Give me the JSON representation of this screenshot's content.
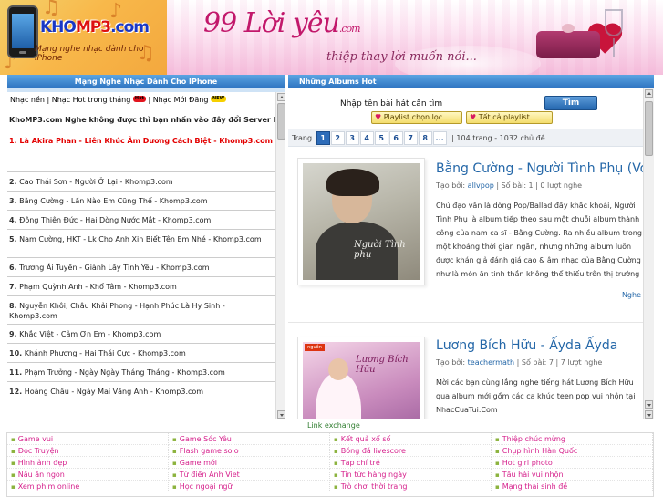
{
  "header": {
    "logo_text_a": "KHO",
    "logo_text_b": "MP3",
    "logo_text_c": ".com",
    "logo_tagline": "Mạng nghe nhạc dành cho iPhone",
    "banner_title": "99 Lời yêu",
    "banner_domain": ".com",
    "banner_subtitle": "thiệp thay lời muốn nói..."
  },
  "left": {
    "heading": "Mạng Nghe Nhạc Dành Cho IPhone",
    "tabs": [
      "Nhạc nền",
      "Nhạc Hot trong tháng",
      "Nhạc Mới Đăng"
    ],
    "tab_sep": " | ",
    "hot_badge": "Hot",
    "new_badge": "NEW",
    "intro": "KhoMP3.com Nghe không được thì bạn nhấn vào đây đổi Server khác",
    "featured_num": "1.",
    "featured": "Là Akira Phan - Liên Khúc Âm Dương Cách Biệt - Khomp3.com",
    "songs": [
      {
        "num": "2.",
        "text": "Cao Thái Sơn - Người Ở Lại - Khomp3.com"
      },
      {
        "num": "3.",
        "text": "Bằng Cường - Lần Nào Em Cũng Thế - Khomp3.com"
      },
      {
        "num": "4.",
        "text": "Đông Thiên Đức - Hai Dòng Nước Mắt - Khomp3.com"
      },
      {
        "num": "5.",
        "text": "Nam Cường, HKT - Lk Cho Anh Xin Biết Tên Em Nhé - Khomp3.com"
      },
      {
        "num": "6.",
        "text": "Trương Ái Tuyền - Giành Lấy Tình Yêu - Khomp3.com"
      },
      {
        "num": "7.",
        "text": "Phạm Quỳnh Anh - Khổ Tâm - Khomp3.com"
      },
      {
        "num": "8.",
        "text": "Nguyễn Khôi, Châu Khải Phong - Hạnh Phúc Là Hy Sinh - Khomp3.com"
      },
      {
        "num": "9.",
        "text": "Khắc Việt - Cảm Ơn Em - Khomp3.com"
      },
      {
        "num": "10.",
        "text": "Khánh Phương - Hai Thái Cực - Khomp3.com"
      },
      {
        "num": "11.",
        "text": "Phạm Trưởng - Ngày Ngày Tháng Tháng - Khomp3.com"
      },
      {
        "num": "12.",
        "text": "Hoàng Châu - Ngày Mai Vắng Anh - Khomp3.com"
      }
    ]
  },
  "right": {
    "heading": "Những Albums Hot",
    "search_value": "Nhập tên bài hát cần tìm",
    "search_button": "Tìm",
    "playlist_chosen": "Playlist chọn lọc",
    "playlist_all": "Tất cả playlist",
    "pager_label": "Trang",
    "pages": [
      "1",
      "2",
      "3",
      "4",
      "5",
      "6",
      "7",
      "8",
      "..."
    ],
    "pager_info": "| 104 trang - 1032 chủ đề",
    "albums": [
      {
        "title": "Bằng Cường - Người Tình Phụ (Vol",
        "meta_prefix": "Tạo bởi: ",
        "author": "allvpop",
        "meta_suffix": " | Số bài: 1 | 0 lượt nghe",
        "desc": "Chủ đạo vẫn là dòng Pop/Ballad đầy khắc khoải, Người Tình Phụ là album tiếp theo sau một chuỗi album thành công của nam ca sĩ - Bằng Cường. Ra nhiều album trong một khoảng thời gian ngắn, nhưng những album luôn được khán giả đánh giá cao & âm nhạc của Bằng Cường như là món ăn tinh thần không thể thiếu trên thị trường nhạc Việt. (Đang cập nhật...)",
        "more": "Nghe",
        "cover_text": "Người Tình phụ"
      },
      {
        "title": "Lương Bích Hữu - Ấyda Ấyda",
        "meta_prefix": "Tạo bởi: ",
        "author": "teachermath",
        "meta_suffix": " | Số bài: 7 | 7 lượt nghe",
        "desc": "Mời các bạn cùng lắng nghe tiếng hát Lương Bích Hữu qua album mới gồm các ca khúc teen pop vui nhộn tại NhacCuaTui.Com",
        "more": "",
        "cover_text": "Lương Bích Hữu",
        "cover_logo": "nguồn"
      }
    ]
  },
  "footer": {
    "link_exchange": "Link exchange",
    "links": [
      "Game vui",
      "Game Sóc Yêu",
      "Kết quả xổ số",
      "Thiệp chúc mừng",
      "Đọc Truyện",
      "Flash game solo",
      "Bóng đá livescore",
      "Chụp hình Hàn Quốc",
      "Hình ảnh đẹp",
      "Game mới",
      "Tạp chí trẻ",
      "Hot girl photo",
      "Nấu ăn ngon",
      "Từ điển Anh Viet",
      "Tin tức hàng ngày",
      "Tấu hài vui nhộn",
      "Xem phim online",
      "Học ngoại ngữ",
      "Trò chơi thời trang",
      "Mạng thai sinh đề"
    ]
  },
  "colors": {
    "accent_blue": "#2d73c0",
    "link_pink": "#d6218c",
    "featured_red": "#e30000",
    "title_blue": "#2467a8"
  },
  "icons": [
    "music-note-icon",
    "phone-icon",
    "heart-icon",
    "gift-icon",
    "scroll-up-icon",
    "scroll-down-icon",
    "playlist-icon"
  ]
}
